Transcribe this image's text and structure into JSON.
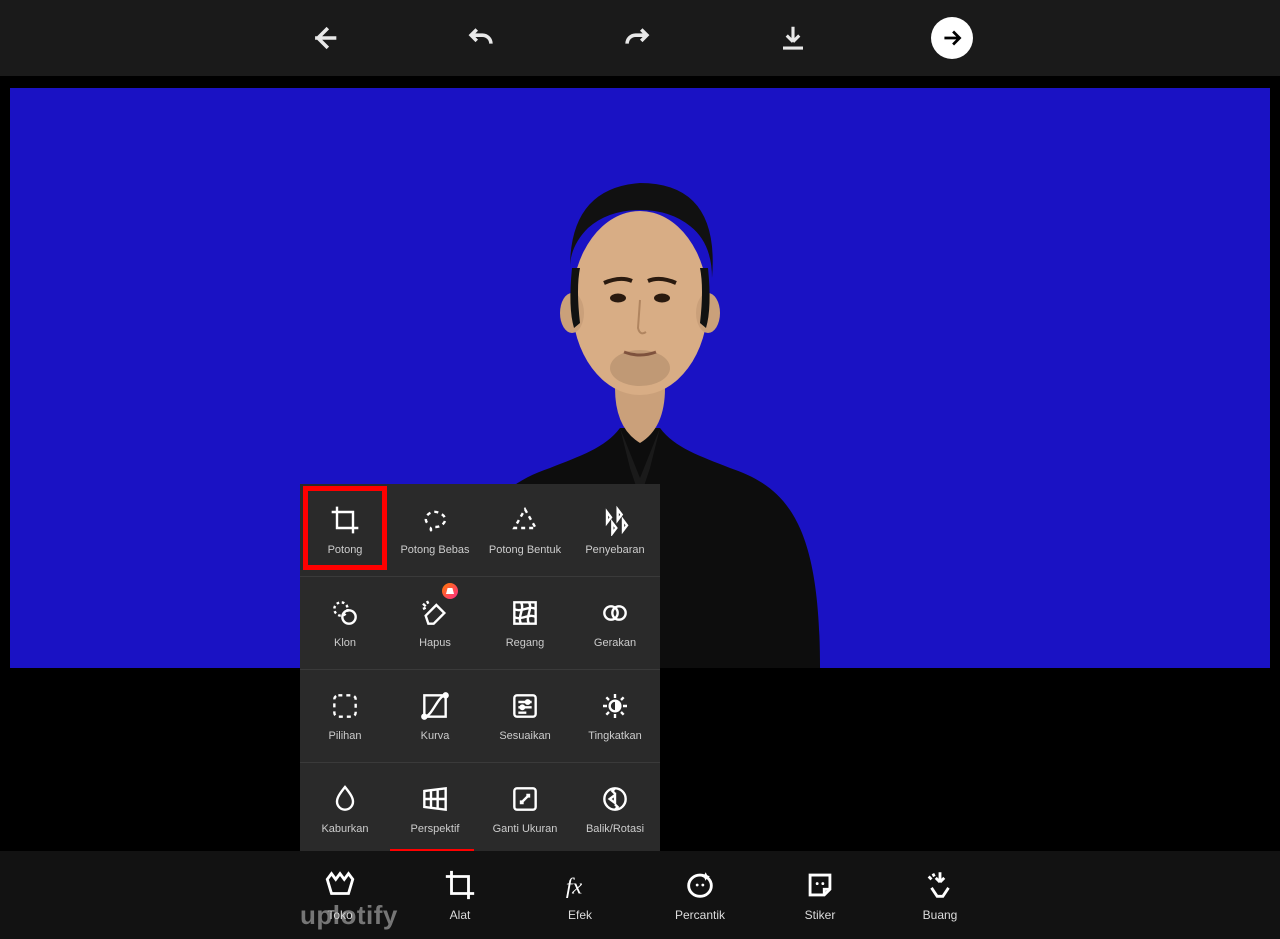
{
  "canvas": {
    "bg_color": "#1a12c4"
  },
  "highlight_color": "#ff0000",
  "watermark": "uplotify",
  "tool_popup": {
    "rows": [
      [
        {
          "key": "potong",
          "label": "Potong",
          "icon": "crop"
        },
        {
          "key": "potong_bebas",
          "label": "Potong Bebas",
          "icon": "lasso"
        },
        {
          "key": "potong_bentuk",
          "label": "Potong Bentuk",
          "icon": "shape-dash"
        },
        {
          "key": "penyebaran",
          "label": "Penyebaran",
          "icon": "scatter"
        }
      ],
      [
        {
          "key": "klon",
          "label": "Klon",
          "icon": "clone"
        },
        {
          "key": "hapus",
          "label": "Hapus",
          "icon": "eraser",
          "badge": true
        },
        {
          "key": "regang",
          "label": "Regang",
          "icon": "meshwarp"
        },
        {
          "key": "gerakan",
          "label": "Gerakan",
          "icon": "motion"
        }
      ],
      [
        {
          "key": "pilihan",
          "label": "Pilihan",
          "icon": "select-dash"
        },
        {
          "key": "kurva",
          "label": "Kurva",
          "icon": "curve"
        },
        {
          "key": "sesuaikan",
          "label": "Sesuaikan",
          "icon": "adjust-sliders"
        },
        {
          "key": "tingkatkan",
          "label": "Tingkatkan",
          "icon": "enhance-sun"
        }
      ],
      [
        {
          "key": "kaburkan",
          "label": "Kaburkan",
          "icon": "blur-drop"
        },
        {
          "key": "perspektif",
          "label": "Perspektif",
          "icon": "perspective"
        },
        {
          "key": "ganti_ukuran",
          "label": "Ganti Ukuran",
          "icon": "resize"
        },
        {
          "key": "balik_rotasi",
          "label": "Balik/Rotasi",
          "icon": "flip-rotate"
        }
      ]
    ]
  },
  "bottom": {
    "items": [
      {
        "key": "toko",
        "label": "Toko",
        "icon": "crown"
      },
      {
        "key": "alat",
        "label": "Alat",
        "icon": "crop"
      },
      {
        "key": "efek",
        "label": "Efek",
        "icon": "fx"
      },
      {
        "key": "percantik",
        "label": "Percantik",
        "icon": "face"
      },
      {
        "key": "stiker",
        "label": "Stiker",
        "icon": "sticker"
      },
      {
        "key": "buang",
        "label": "Buang",
        "icon": "remove-magic"
      }
    ]
  }
}
